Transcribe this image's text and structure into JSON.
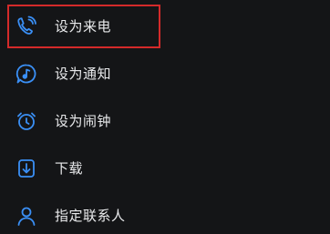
{
  "menu": {
    "items": [
      {
        "label": "设为来电",
        "icon": "phone-ring-icon"
      },
      {
        "label": "设为通知",
        "icon": "music-note-bubble-icon"
      },
      {
        "label": "设为闹钟",
        "icon": "alarm-clock-icon"
      },
      {
        "label": "下载",
        "icon": "download-icon"
      },
      {
        "label": "指定联系人",
        "icon": "person-icon"
      }
    ],
    "highlighted_index": 0
  },
  "colors": {
    "background": "#141517",
    "icon_accent": "#3a8ff5",
    "text": "#e9eaec",
    "highlight_border": "#d42a2a"
  }
}
